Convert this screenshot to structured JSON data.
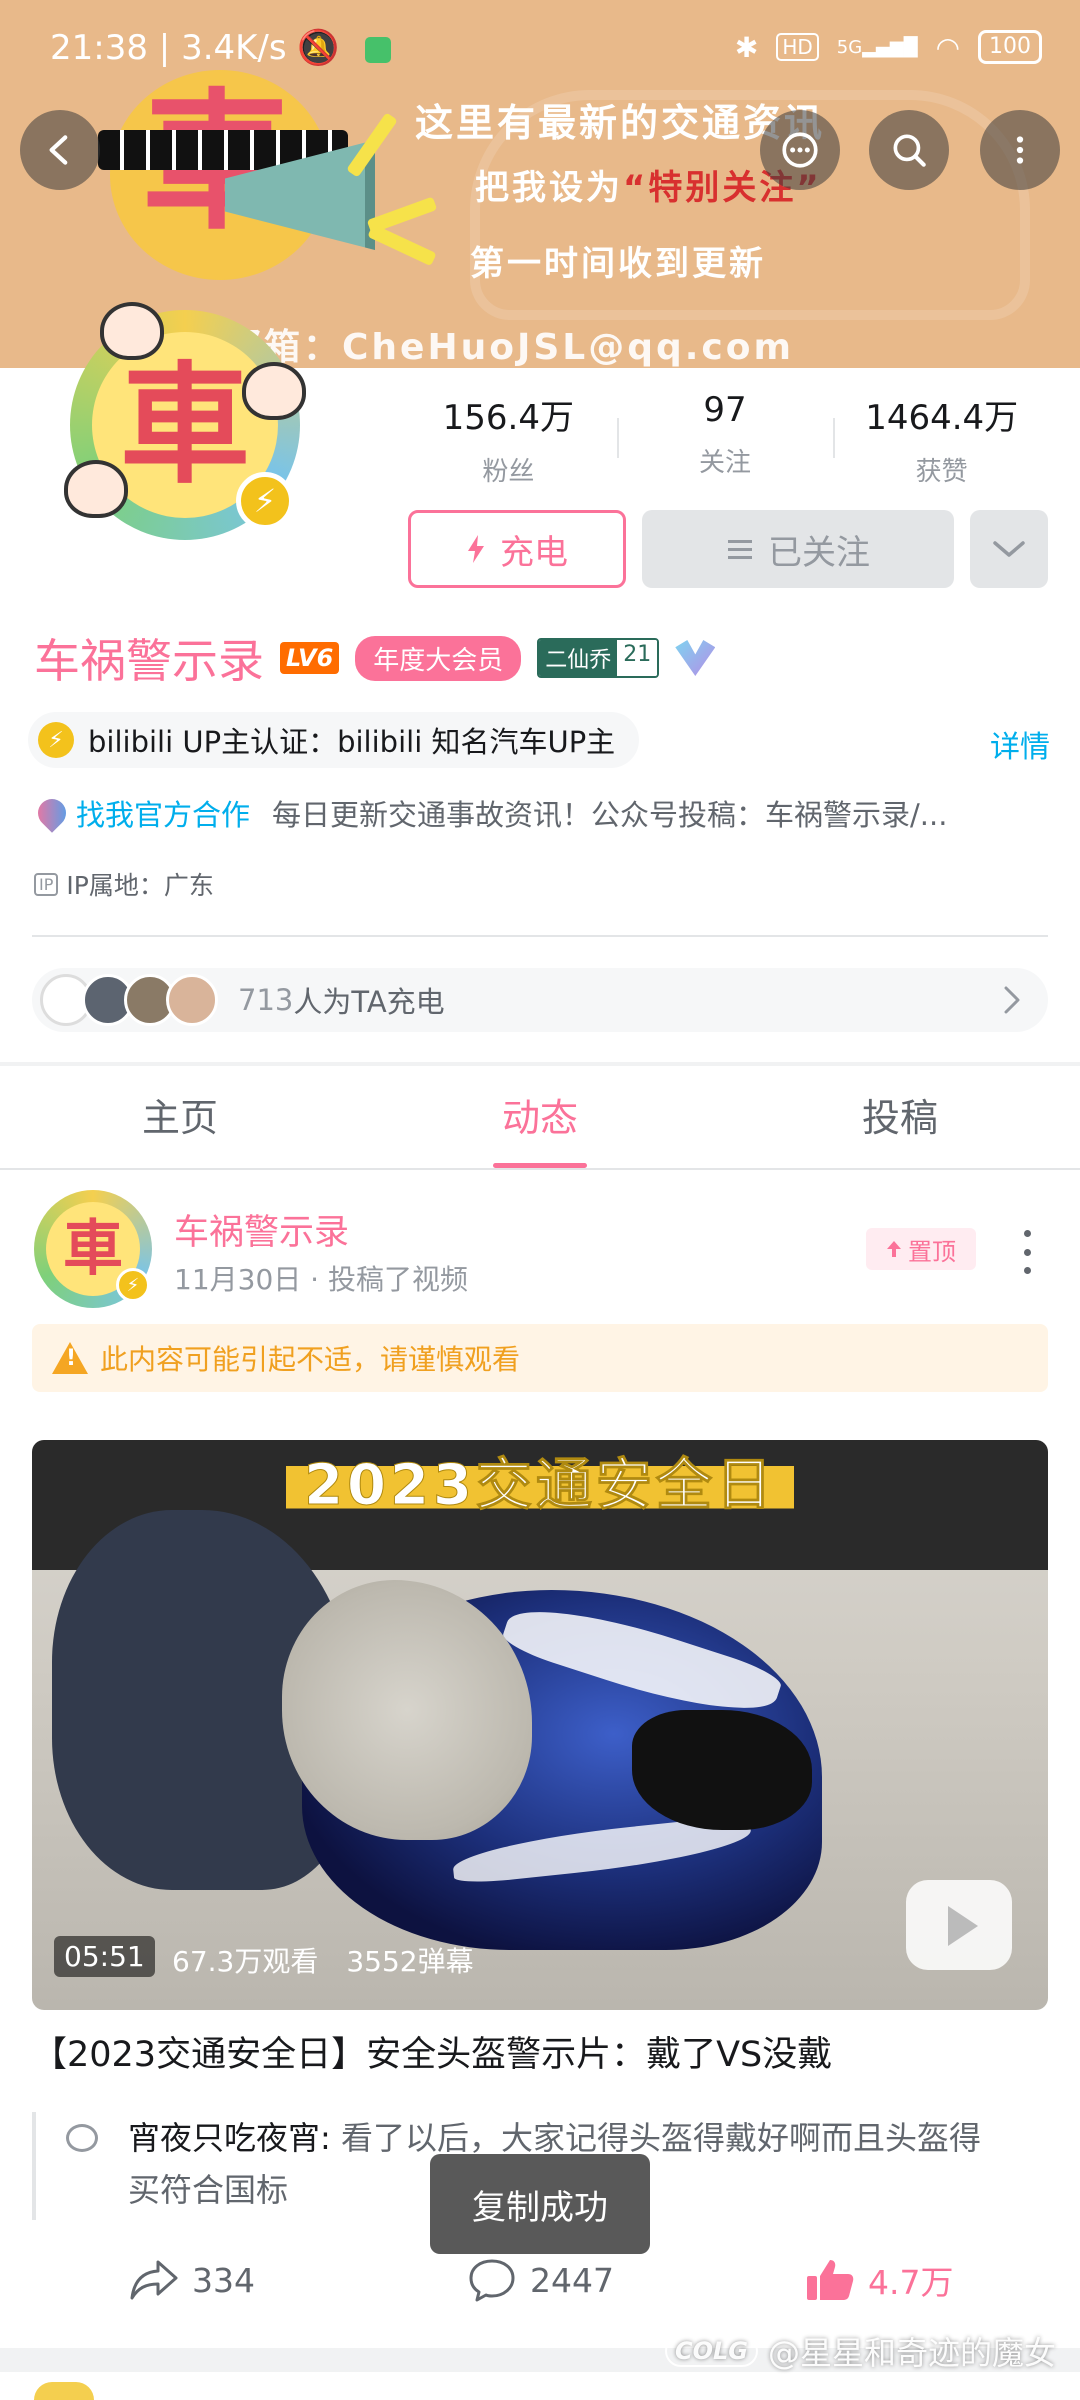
{
  "status_bar": {
    "time": "21:38",
    "speed": "3.4K/s",
    "network": "5G",
    "hd": "HD",
    "battery": "100"
  },
  "banner": {
    "line1": "这里有最新的交通资讯",
    "line2_prefix": "把我设为",
    "line2_highlight": "“特别关注”",
    "line3": "第一时间收到更新",
    "line4": "邮箱：CheHuoJSL@qq.com",
    "logo_char": "車"
  },
  "profile": {
    "avatar_char": "車",
    "stats": [
      {
        "value": "156.4万",
        "label": "粉丝"
      },
      {
        "value": "97",
        "label": "关注"
      },
      {
        "value": "1464.4万",
        "label": "获赞"
      }
    ],
    "charge_button": "充电",
    "follow_button": "已关注",
    "name": "车祸警示录",
    "level": "LV6",
    "vip_label": "年度大会员",
    "medal_name": "二仙乔",
    "medal_level": "21",
    "cert_text": "bilibili UP主认证：bilibili 知名汽车UP主",
    "cert_detail": "详情",
    "coop_link": "找我官方合作",
    "bio": "每日更新交通事故资讯！公众号投稿：车祸警示录/...",
    "ip_tag": "IP",
    "ip_location": "IP属地：广东",
    "charge_count": "713",
    "charge_text": "人为TA充电"
  },
  "tabs": [
    {
      "label": "主页",
      "active": false
    },
    {
      "label": "动态",
      "active": true
    },
    {
      "label": "投稿",
      "active": false
    }
  ],
  "post": {
    "author": "车祸警示录",
    "avatar_char": "車",
    "meta": "11月30日 · 投稿了视频",
    "pin_label": "置顶",
    "warning": "此内容可能引起不适，请谨慎观看",
    "video": {
      "overlay_title": "2023交通安全日",
      "duration": "05:51",
      "views": "67.3万观看",
      "danmaku": "3552弹幕"
    },
    "title": "【2023交通安全日】安全头盔警示片：戴了VS没戴",
    "comment_user": "宵夜只吃夜宵:",
    "comment_text": " 看了以后，大家记得头盔得戴好啊而且头盔得买符合国标",
    "share_count": "334",
    "comment_count": "2447",
    "like_count": "4.7万"
  },
  "toast": "复制成功",
  "watermark": {
    "logo": "COLG",
    "text": "@星星和奇迹的魔女"
  },
  "colors": {
    "accent_pink": "#fb7299",
    "link_blue": "#00aeec",
    "banner_bg": "#e8b98a",
    "warning_orange": "#f5a623"
  }
}
